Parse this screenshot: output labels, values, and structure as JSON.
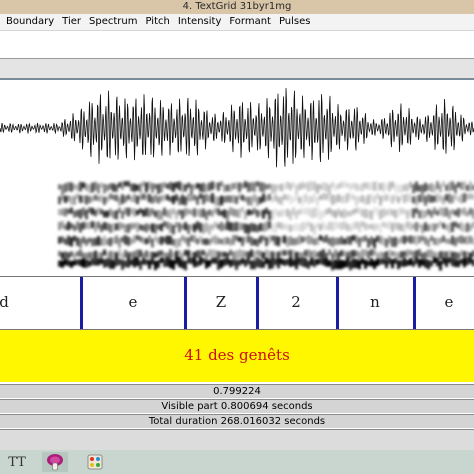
{
  "window": {
    "title": "4. TextGrid 31byr1mg"
  },
  "menu": [
    "Boundary",
    "Tier",
    "Spectrum",
    "Pitch",
    "Intensity",
    "Formant",
    "Pulses"
  ],
  "interval_tier": {
    "segments": [
      {
        "label": "d"
      },
      {
        "label": "e"
      },
      {
        "label": "Z"
      },
      {
        "label": "2"
      },
      {
        "label": "n"
      },
      {
        "label": "e"
      }
    ]
  },
  "point_tier": {
    "label": "41 des genêts"
  },
  "status": {
    "cursor_time": "0.799224",
    "visible_part": "Visible part 0.800694 seconds",
    "total_duration": "Total duration 268.016032 seconds"
  },
  "taskbar": {
    "start_glyph": "TT",
    "icons": [
      "praat-icon",
      "paint-icon"
    ]
  },
  "colors": {
    "title_bg": "#d9c5a8",
    "boundary": "#1b1ba8",
    "point_tier_bg": "#fff700",
    "point_label": "#cc1010"
  }
}
